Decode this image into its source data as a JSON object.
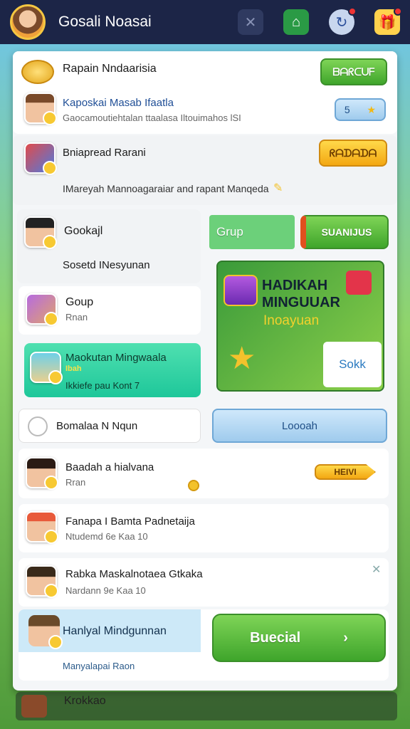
{
  "header": {
    "title": "Gosali Noasai"
  },
  "rows": {
    "r1": {
      "title": "Rapain Nndaarisia",
      "button": "ᗷᗩᖇᑕᑌᖴ"
    },
    "r2": {
      "title": "Kaposkai Masab Ifaatla",
      "subtitle": "Gaocamoutiehtalan ttaalasa Iltouimahos lSI",
      "counter": "5"
    },
    "r3": {
      "title": "Bniapread Rarani",
      "subtitle": "IMareyah Mannoagaraiar and rapant Manqeda",
      "button": "ᖇᗩᗪᗩᗪᗩ"
    },
    "r4": {
      "title": "Gookajl",
      "subtitle": "Sosetd INesyunan",
      "tab": "Grup",
      "button": "SUANIJUS"
    },
    "r5": {
      "title": "Goup",
      "subtitle": "Rnan"
    },
    "r6": {
      "title": "Maokutan Mingwaala",
      "subtitle": "Ikkiefe pau Kont 7",
      "small": "Ibah"
    },
    "promo": {
      "title_line1": "HADIKAH",
      "title_line2": "MINGUUAR",
      "subtitle": "Inoayuan",
      "button": "Sokk"
    },
    "r7": {
      "title": "Bomalaa N Nqun",
      "button": "Loooah"
    },
    "r8": {
      "title": "Baadah a hialvana",
      "subtitle": "Rran",
      "button": "HEIVI"
    },
    "r9": {
      "title": "Fanapa I Bamta Padnetaija",
      "subtitle": "Ntudemd 6e Kaa 10"
    },
    "r10": {
      "title": "Rabka Maskalnotaea Gtkaka",
      "subtitle": "Nardann 9e Kaa 10"
    },
    "r11": {
      "title": "Hanlyal Mindgunnan",
      "subtitle": "Manyalapai Raon",
      "button": "Buecial"
    },
    "bottom": {
      "title": "Krokkao"
    }
  },
  "colors": {
    "accent_green": "#3fa52b",
    "accent_yellow": "#f3a712",
    "header_bg": "#1c2547"
  }
}
